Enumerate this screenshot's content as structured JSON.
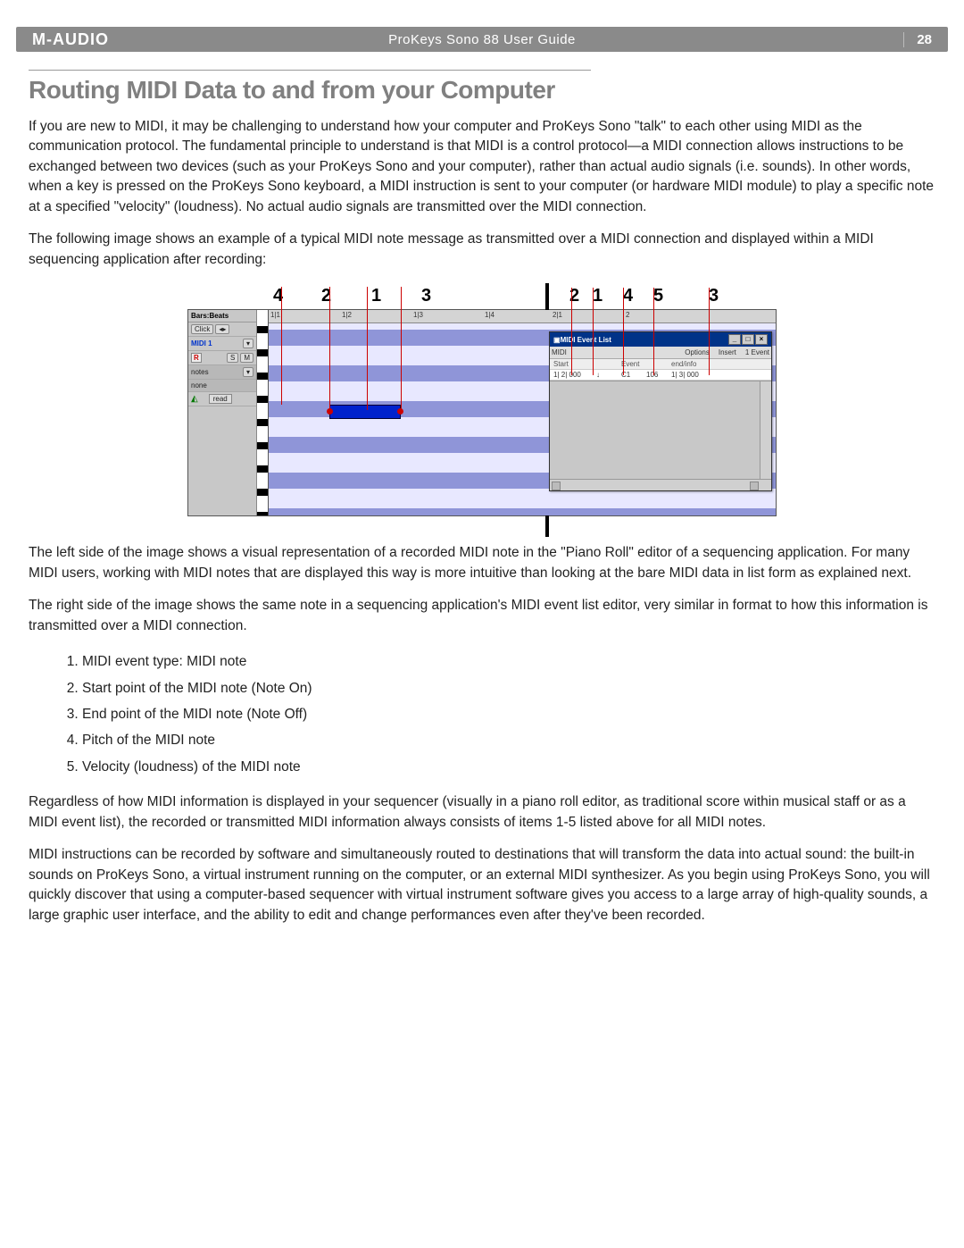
{
  "header": {
    "brand": "M-AUDIO",
    "title": "ProKeys Sono 88 User Guide",
    "page": "28"
  },
  "section_title": "Routing MIDI Data to and from your Computer",
  "paragraphs": {
    "p1": "If you are new to MIDI, it may be challenging to understand how your computer and ProKeys Sono \"talk\" to each other using MIDI as the communication protocol.  The fundamental principle to understand is that MIDI is a control protocol—a MIDI connection allows instructions to be exchanged between two devices (such as your ProKeys Sono and your computer), rather than actual audio signals (i.e. sounds).  In other words, when a key is pressed on the ProKeys Sono keyboard, a MIDI instruction is sent to your computer (or hardware MIDI module) to play a specific note at a specified \"velocity\" (loudness).  No actual audio signals are transmitted over the MIDI connection.",
    "p2": "The following image shows an example of a typical MIDI note message as transmitted over a MIDI connection and displayed within a MIDI sequencing application after recording:",
    "p3": "The left side of the image shows a visual representation of a recorded MIDI note in the \"Piano Roll\" editor of a sequencing application. For many MIDI users, working with MIDI notes that are displayed this way is more intuitive than looking at the bare MIDI data in list form as explained next.",
    "p4": "The right side of the image shows the same note in a sequencing application's MIDI event list editor, very similar in format to how this information is transmitted over a MIDI connection.",
    "p5": "Regardless of how MIDI information is displayed in your sequencer (visually in a piano roll editor, as traditional score within musical staff or as a MIDI event list), the recorded or transmitted MIDI information always consists of items 1-5 listed above for all MIDI notes.",
    "p6": "MIDI instructions can be recorded by software and simultaneously routed to destinations that will transform the data into actual sound: the built-in sounds on ProKeys Sono, a virtual instrument running on the computer, or an external MIDI synthesizer. As you begin using ProKeys Sono, you will quickly discover that using a computer-based sequencer with virtual instrument software gives you access to a large array of high-quality sounds, a large graphic user interface, and the ability to edit and change performances even after they've been recorded."
  },
  "list": [
    "MIDI event type: MIDI note",
    "Start point of the MIDI note (Note On)",
    "End point of the MIDI note (Note Off)",
    "Pitch of the MIDI note",
    "Velocity (loudness) of the MIDI note"
  ],
  "callouts_left": [
    "4",
    "2",
    "1",
    "3"
  ],
  "callouts_right": [
    "2",
    "1",
    "4",
    "5",
    "3"
  ],
  "diagram": {
    "sidebar": {
      "bars_beats": "Bars:Beats",
      "click": "Click",
      "track_name": "MIDI 1",
      "rec": "R",
      "solo": "S",
      "mute": "M",
      "notes": "notes",
      "none": "none",
      "read": "read"
    },
    "ruler": {
      "m11": "1|1",
      "m12": "1|2",
      "m13": "1|3",
      "m14": "1|4",
      "m21": "2|1",
      "m2": "2"
    },
    "eventlist": {
      "title": "MIDI Event List",
      "menu": {
        "midi": "MIDI",
        "options": "Options",
        "insert": "Insert",
        "count": "1 Event"
      },
      "cols": {
        "start": "Start",
        "event": "Event",
        "endinfo": "end/info"
      },
      "row": {
        "start": "1| 2| 000",
        "flag": "↓",
        "note": "C1",
        "vel": "106",
        "end": "1| 3| 000"
      }
    }
  }
}
